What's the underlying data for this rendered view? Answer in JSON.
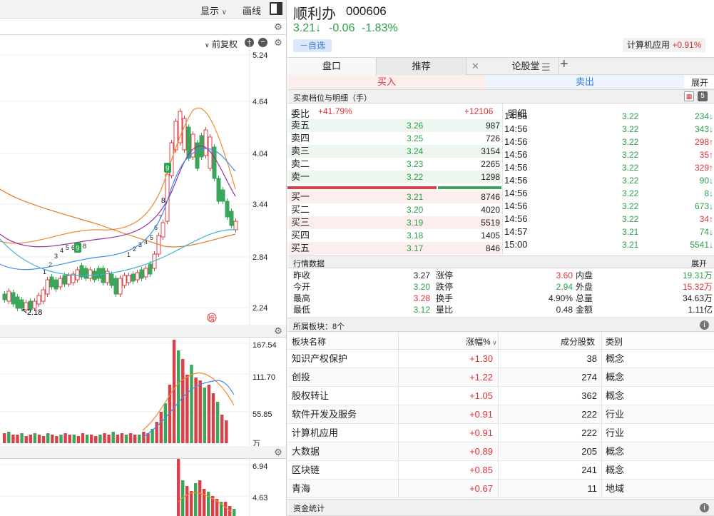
{
  "toolbar": {
    "display_label": "显示",
    "draw_label": "画线"
  },
  "kline": {
    "adjust_label": "前复权",
    "price_ticks": [
      "5.24",
      "4.64",
      "4.04",
      "3.44",
      "2.84",
      "2.24"
    ],
    "low_label": "2.18",
    "markers": [
      "9",
      "8",
      "9"
    ],
    "seq_labels": [
      "1",
      "2",
      "3",
      "4",
      "5",
      "6",
      "7",
      "8",
      "1",
      "2",
      "3",
      "4",
      "5",
      "6",
      "7"
    ]
  },
  "volume": {
    "ticks": [
      "167.54",
      "111.70",
      "55.85",
      "万"
    ]
  },
  "indicator": {
    "ticks": [
      "6.94",
      "4.63"
    ]
  },
  "stock": {
    "name": "顺利办",
    "code": "000606",
    "price": "3.21↓",
    "change": "-0.06",
    "pct": "-1.83%",
    "watch_label": "－自选",
    "sector_name": "计算机应用",
    "sector_pct": "+0.91%"
  },
  "tabs": [
    "盘口",
    "推荐",
    "论股堂"
  ],
  "trade": {
    "buy": "买入",
    "sell": "卖出",
    "expand": "展开"
  },
  "orderbook": {
    "title": "买卖档位与明细（手）",
    "badge": "5",
    "weibi_label": "委比",
    "weibi_value": "+41.79%",
    "weibi_diff": "+12106",
    "sells": [
      {
        "label": "卖五",
        "price": "3.26",
        "vol": "987"
      },
      {
        "label": "卖四",
        "price": "3.25",
        "vol": "726"
      },
      {
        "label": "卖三",
        "price": "3.24",
        "vol": "3154"
      },
      {
        "label": "卖二",
        "price": "3.23",
        "vol": "2265"
      },
      {
        "label": "卖一",
        "price": "3.22",
        "vol": "1298"
      }
    ],
    "buys": [
      {
        "label": "买一",
        "price": "3.21",
        "vol": "8746"
      },
      {
        "label": "买二",
        "price": "3.20",
        "vol": "4020"
      },
      {
        "label": "买三",
        "price": "3.19",
        "vol": "5519"
      },
      {
        "label": "买四",
        "price": "3.18",
        "vol": "1405"
      },
      {
        "label": "买五",
        "price": "3.17",
        "vol": "846"
      }
    ]
  },
  "ticks": {
    "title": "明细",
    "rows": [
      {
        "time": "14:56",
        "price": "3.22",
        "vol": "234↓",
        "dir": "green"
      },
      {
        "time": "14:56",
        "price": "3.22",
        "vol": "343↓",
        "dir": "green"
      },
      {
        "time": "14:56",
        "price": "3.22",
        "vol": "298↑",
        "dir": "red"
      },
      {
        "time": "14:56",
        "price": "3.22",
        "vol": "35↑",
        "dir": "red"
      },
      {
        "time": "14:56",
        "price": "3.22",
        "vol": "329↑",
        "dir": "red"
      },
      {
        "time": "14:56",
        "price": "3.22",
        "vol": "90↓",
        "dir": "green"
      },
      {
        "time": "14:56",
        "price": "3.22",
        "vol": "8↓",
        "dir": "green"
      },
      {
        "time": "14:56",
        "price": "3.22",
        "vol": "673↓",
        "dir": "green"
      },
      {
        "time": "14:56",
        "price": "3.22",
        "vol": "34↑",
        "dir": "red"
      },
      {
        "time": "14:57",
        "price": "3.21",
        "vol": "74↓",
        "dir": "green"
      },
      {
        "time": "15:00",
        "price": "3.21",
        "vol": "5541↓",
        "dir": "green"
      }
    ]
  },
  "quote": {
    "title": "行情数据",
    "expand": "展开",
    "rows": [
      {
        "l1": "昨收",
        "v1": "3.27",
        "c1": "",
        "l2": "涨停",
        "v2": "3.60",
        "c2": "red",
        "l3": "内盘",
        "v3": "19.31万",
        "c3": "green"
      },
      {
        "l1": "今开",
        "v1": "3.20",
        "c1": "green",
        "l2": "跌停",
        "v2": "2.94",
        "c2": "green",
        "l3": "外盘",
        "v3": "15.32万",
        "c3": "red"
      },
      {
        "l1": "最高",
        "v1": "3.28",
        "c1": "red",
        "l2": "换手",
        "v2": "4.90%",
        "c2": "",
        "l3": "总量",
        "v3": "34.63万",
        "c3": ""
      },
      {
        "l1": "最低",
        "v1": "3.12",
        "c1": "green",
        "l2": "量比",
        "v2": "0.48",
        "c2": "",
        "l3": "金额",
        "v3": "1.11亿",
        "c3": ""
      }
    ]
  },
  "sectors": {
    "title": "所属板块：8个",
    "headers": {
      "name": "板块名称",
      "pct": "涨幅%",
      "count": "成分股数",
      "type": "类别"
    },
    "rows": [
      {
        "name": "知识产权保护",
        "pct": "+1.30",
        "count": "38",
        "type": "概念"
      },
      {
        "name": "创投",
        "pct": "+1.22",
        "count": "274",
        "type": "概念"
      },
      {
        "name": "股权转让",
        "pct": "+1.05",
        "count": "362",
        "type": "概念"
      },
      {
        "name": "软件开发及服务",
        "pct": "+0.91",
        "count": "222",
        "type": "行业"
      },
      {
        "name": "计算机应用",
        "pct": "+0.91",
        "count": "222",
        "type": "行业"
      },
      {
        "name": "大数据",
        "pct": "+0.89",
        "count": "205",
        "type": "概念"
      },
      {
        "name": "区块链",
        "pct": "+0.85",
        "count": "241",
        "type": "概念"
      },
      {
        "name": "青海",
        "pct": "+0.67",
        "count": "11",
        "type": "地域"
      }
    ]
  },
  "funds": {
    "title": "资金统计"
  },
  "colors": {
    "red": "#e0323a",
    "green": "#2aa14a",
    "accent": "#3b7ddd"
  }
}
